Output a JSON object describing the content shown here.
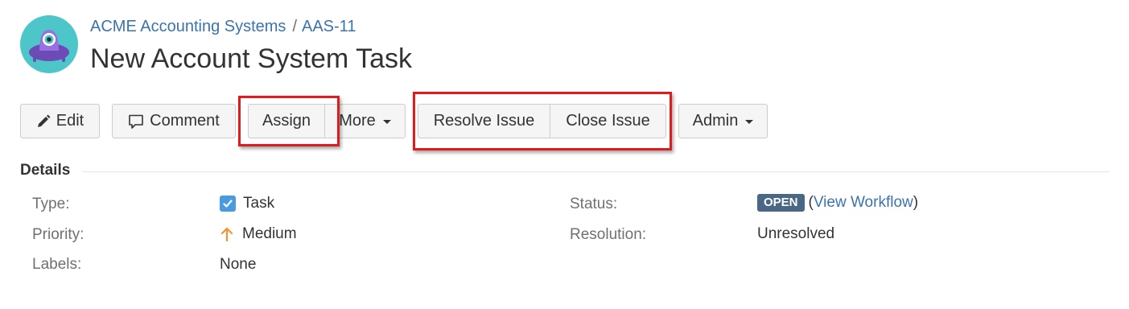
{
  "header": {
    "project_name": "ACME Accounting Systems",
    "breadcrumb_separator": "/",
    "issue_key": "AAS-11",
    "title": "New Account System Task",
    "avatar_icon": "project-alien-avatar-icon"
  },
  "toolbar": {
    "edit_label": "Edit",
    "comment_label": "Comment",
    "assign_label": "Assign",
    "more_label": "More",
    "resolve_label": "Resolve Issue",
    "close_label": "Close Issue",
    "admin_label": "Admin"
  },
  "highlights": {
    "color": "#e01b1b",
    "targets": [
      "Assign",
      "Resolve Issue / Close Issue"
    ]
  },
  "details": {
    "section_title": "Details",
    "left_fields": [
      {
        "label": "Type:",
        "value": "Task",
        "icon": "task-checkbox-icon"
      },
      {
        "label": "Priority:",
        "value": "Medium",
        "icon": "arrow-up-icon"
      },
      {
        "label": "Labels:",
        "value": "None"
      }
    ],
    "right_fields": [
      {
        "label": "Status:",
        "badge": "OPEN",
        "paren_open": "(",
        "link": "View Workflow",
        "paren_close": ")"
      },
      {
        "label": "Resolution:",
        "value": "Unresolved"
      }
    ]
  },
  "colors": {
    "link": "#3b73af",
    "status_badge": "#4a6785",
    "task_icon": "#4a9ae1",
    "priority_medium": "#f79232"
  }
}
